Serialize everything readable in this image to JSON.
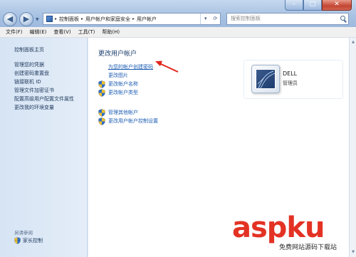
{
  "window": {
    "controls": {
      "minimize": "–",
      "maximize": "□",
      "close": "✕"
    }
  },
  "address_bar": {
    "crumbs": [
      "控制面板",
      "用户帐户和家庭安全",
      "用户帐户"
    ],
    "separator": "▸"
  },
  "search": {
    "placeholder": "搜索控制面板"
  },
  "menu": [
    "文件(F)",
    "编辑(E)",
    "查看(V)",
    "工具(T)",
    "帮助(H)"
  ],
  "sidebar": {
    "home": "控制面板主页",
    "items": [
      "管理您的凭据",
      "创建密码重置盘",
      "链接联机 ID",
      "管理文件加密证书",
      "配置高级用户配置文件属性",
      "更改我的环境变量"
    ],
    "see_also": "另请参阅",
    "family_safety": "家长控制"
  },
  "main": {
    "title": "更改用户帐户",
    "links": [
      {
        "label": "为您的帐户创建密码",
        "shield": false,
        "active": true
      },
      {
        "label": "更改图片",
        "shield": false
      },
      {
        "label": "更改帐户名称",
        "shield": true
      },
      {
        "label": "更改帐户类型",
        "shield": true
      }
    ],
    "links2": [
      {
        "label": "管理其他帐户",
        "shield": true
      },
      {
        "label": "更改用户帐户控制设置",
        "shield": true
      }
    ]
  },
  "user": {
    "name": "DELL",
    "role": "管理员"
  },
  "watermark": {
    "main": "aspku",
    "sub": "免费网站源码下载站"
  },
  "colors": {
    "link": "#1c5db3",
    "title": "#1c3f6e",
    "arrow": "#e0241b",
    "watermark": "#e33224"
  }
}
